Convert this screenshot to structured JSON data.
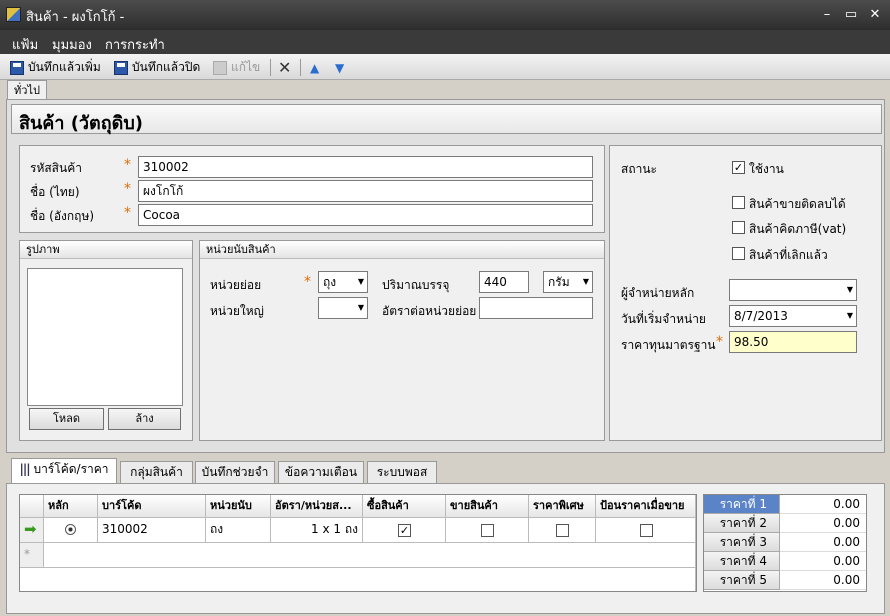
{
  "window": {
    "title": "สินค้า - ผงโกโก้ -",
    "minimize": "–",
    "maximize": "▭",
    "close": "✕"
  },
  "menu": [
    "แฟ้ม",
    "มุมมอง",
    "การกระทำ"
  ],
  "toolbar": {
    "save_new": "บันทึกแล้วเพิ่ม",
    "save_close": "บันทึกแล้วปิด",
    "edit": "แก้ไข"
  },
  "top_tab": "ทั่วไป",
  "header": "สินค้า (วัตถุดิบ)",
  "product": {
    "code_label": "รหัสสินค้า",
    "code": "310002",
    "name_th_label": "ชื่อ (ไทย)",
    "name_th": "ผงโกโก้",
    "name_en_label": "ชื่อ (อังกฤษ)",
    "name_en": "Cocoa",
    "required_mark": "*"
  },
  "image_group": {
    "title": "รูปภาพ",
    "load": "โหลด",
    "clear": "ล้าง"
  },
  "unit_group": {
    "title": "หน่วยนับสินค้า",
    "small_unit_label": "หน่วยย่อย",
    "small_unit": "ถุง",
    "large_unit_label": "หน่วยใหญ่",
    "large_unit": "",
    "pack_qty_label": "ปริมาณบรรจุ",
    "pack_qty": "440",
    "pack_unit": "กรัม",
    "ratio_label": "อัตราต่อหน่วยย่อย",
    "ratio": ""
  },
  "status": {
    "label": "สถานะ",
    "active_label": "ใช้งาน",
    "active": true,
    "negative_sale_label": "สินค้าขายติดลบได้",
    "vat_label": "สินค้าคิดภาษี(vat)",
    "discontinued_label": "สินค้าที่เลิกแล้ว",
    "supplier_label": "ผู้จำหน่ายหลัก",
    "supplier": "",
    "start_date_label": "วันที่เริ่มจำหน่าย",
    "start_date": "8/7/2013",
    "std_cost_label": "ราคาทุนมาตรฐาน",
    "std_cost": "98.50"
  },
  "bottom_tabs": [
    "บาร์โค้ด/ราคา",
    "กลุ่มสินค้า",
    "บันทึกช่วยจำ",
    "ข้อความเตือน",
    "ระบบพอส"
  ],
  "grid": {
    "columns": [
      "หลัก",
      "บาร์โค้ด",
      "หน่วยนับ",
      "อัตรา/หน่วยส...",
      "ซื้อสินค้า",
      "ขายสินค้า",
      "ราคาพิเศษ",
      "ป้อนราคาเมื่อขาย"
    ],
    "row": {
      "barcode": "310002",
      "unit": "ถง",
      "ratio": "1 x 1 ถง"
    },
    "new_row_mark": "*"
  },
  "prices": [
    {
      "label": "ราคาที่ 1",
      "value": "0.00"
    },
    {
      "label": "ราคาที่ 2",
      "value": "0.00"
    },
    {
      "label": "ราคาที่ 3",
      "value": "0.00"
    },
    {
      "label": "ราคาที่ 4",
      "value": "0.00"
    },
    {
      "label": "ราคาที่ 5",
      "value": "0.00"
    }
  ]
}
